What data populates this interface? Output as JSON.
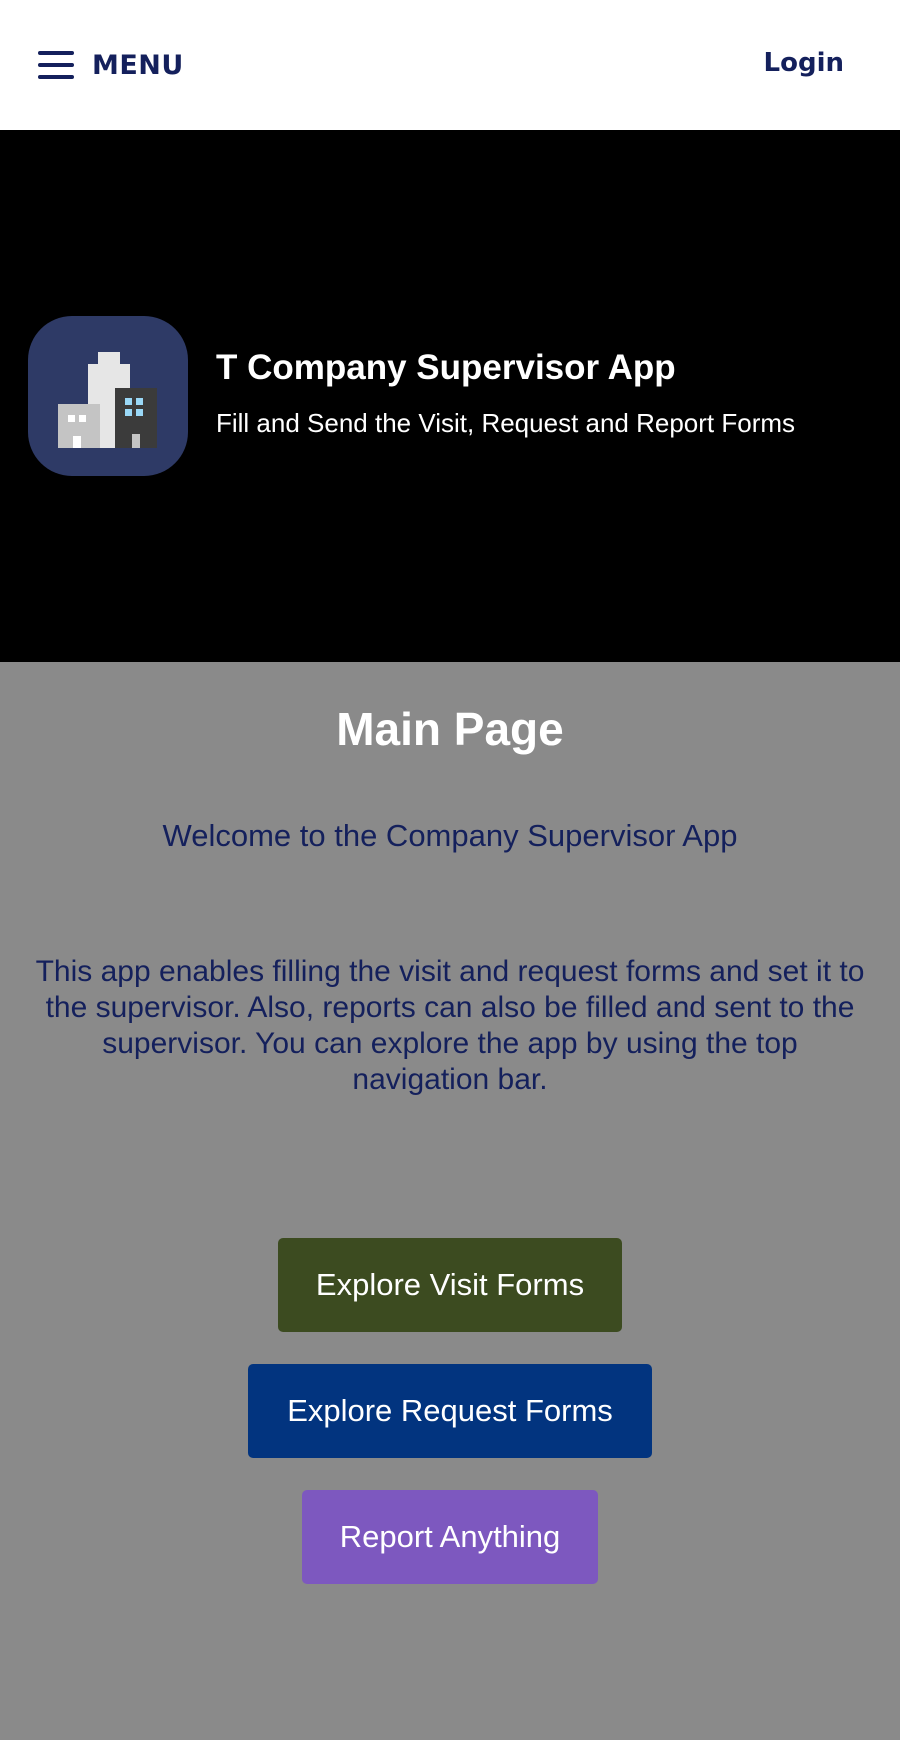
{
  "header": {
    "menu_label": "MENU",
    "login_label": "Login",
    "menu_icon": "hamburger-menu-icon"
  },
  "hero": {
    "icon": "city-buildings-icon",
    "title": "T Company Supervisor App",
    "subtitle": "Fill and Send the Visit, Request and Report Forms"
  },
  "main": {
    "title": "Main Page",
    "welcome": "Welcome to the Company Supervisor App",
    "description": "This app enables filling the visit and request forms and set it to the supervisor. Also, reports can also be filled and sent to the supervisor. You can explore the app by using the top navigation bar.",
    "buttons": {
      "visit": "Explore Visit Forms",
      "request": "Explore Request Forms",
      "report": "Report Anything"
    }
  },
  "colors": {
    "nav_text": "#14205c",
    "hero_background": "#000000",
    "page_background": "#8a8a8a",
    "visit_button": "#3c4b20",
    "request_button": "#02347f",
    "report_button": "#7d58bf",
    "icon_background": "#2e3a66"
  }
}
